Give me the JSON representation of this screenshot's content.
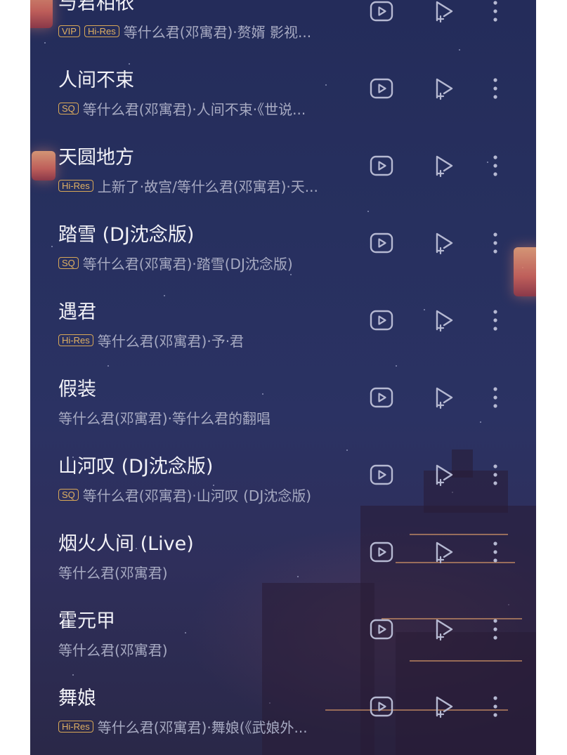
{
  "songs": [
    {
      "title": "与君相依",
      "badges": [
        "VIP",
        "Hi-Res"
      ],
      "subtitle": "等什么君(邓寓君)·赘婿 影视..."
    },
    {
      "title": "人间不束",
      "badges": [
        "SQ"
      ],
      "subtitle": "等什么君(邓寓君)·人间不束·《世说..."
    },
    {
      "title": "天圆地方",
      "badges": [
        "Hi-Res"
      ],
      "subtitle": "上新了·故宫/等什么君(邓寓君)·天..."
    },
    {
      "title": "踏雪 (DJ沈念版)",
      "badges": [
        "SQ"
      ],
      "subtitle": "等什么君(邓寓君)·踏雪(DJ沈念版)"
    },
    {
      "title": "遇君",
      "badges": [
        "Hi-Res"
      ],
      "subtitle": "等什么君(邓寓君)·予·君"
    },
    {
      "title": "假装",
      "badges": [],
      "subtitle": "等什么君(邓寓君)·等什么君的翻唱"
    },
    {
      "title": "山河叹 (DJ沈念版)",
      "badges": [
        "SQ"
      ],
      "subtitle": "等什么君(邓寓君)·山河叹 (DJ沈念版)"
    },
    {
      "title": "烟火人间 (Live)",
      "badges": [],
      "subtitle": "等什么君(邓寓君)"
    },
    {
      "title": "霍元甲",
      "badges": [],
      "subtitle": "等什么君(邓寓君)"
    },
    {
      "title": "舞娘",
      "badges": [
        "Hi-Res"
      ],
      "subtitle": "等什么君(邓寓君)·舞娘(《武娘外..."
    }
  ],
  "icons": {
    "play": "play-mv-icon",
    "add": "add-to-playlist-icon",
    "more": "more-vertical-icon"
  },
  "colors": {
    "title": "#f2f2f7",
    "subtitle": "#a7aac2",
    "badge": "#d9a857",
    "icon": "#b6b9d2"
  }
}
